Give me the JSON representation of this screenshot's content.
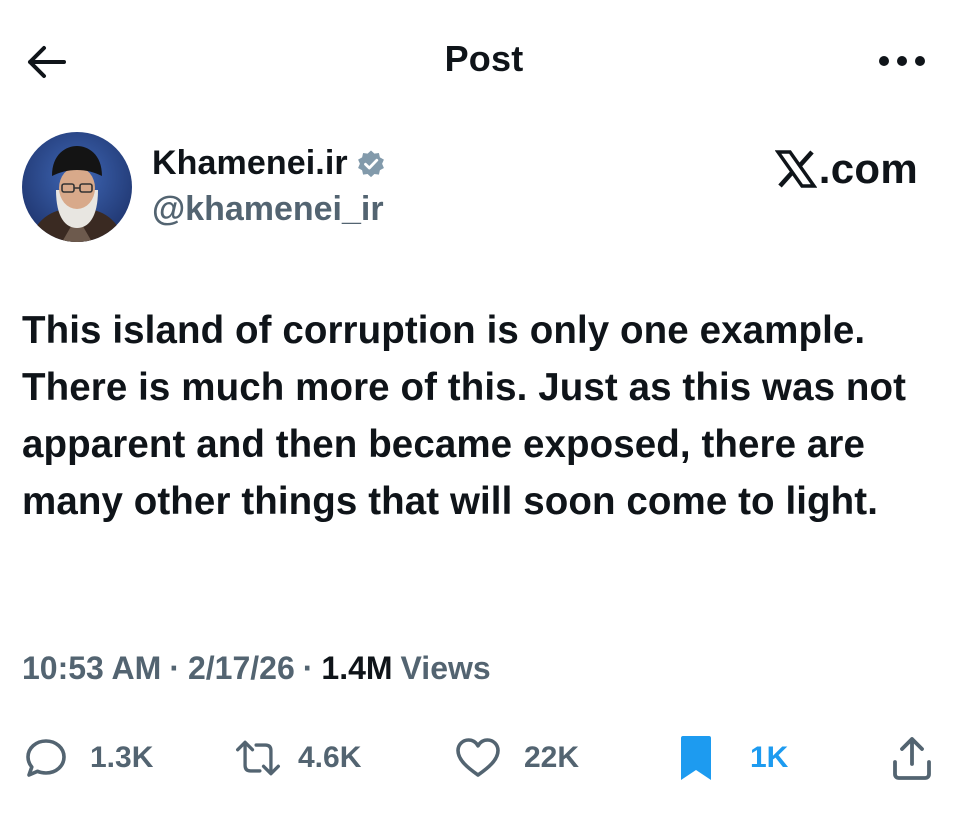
{
  "header": {
    "title": "Post"
  },
  "author": {
    "name": "Khamenei.ir",
    "handle": "@khamenei_ir",
    "verified": true
  },
  "source": {
    "label": ".com",
    "logo_icon": "x-logo-icon"
  },
  "post": {
    "text": "This island of corruption is only one example. There is much more of this. Just as this was not apparent and then became exposed, there are many other things that will soon come to light."
  },
  "meta": {
    "time": "10:53 AM",
    "date": "2/17/26",
    "views_count": "1.4M",
    "views_label": "Views",
    "separator": "·"
  },
  "actions": {
    "reply": {
      "icon": "reply-icon",
      "count": "1.3K"
    },
    "repost": {
      "icon": "repost-icon",
      "count": "4.6K"
    },
    "like": {
      "icon": "heart-icon",
      "count": "22K"
    },
    "bookmark": {
      "icon": "bookmark-icon",
      "count": "1K",
      "active": true
    },
    "share": {
      "icon": "share-icon"
    }
  },
  "colors": {
    "text_primary": "#0f1419",
    "text_secondary": "#536471",
    "accent_blue": "#1d9bf0",
    "background": "#ffffff"
  }
}
